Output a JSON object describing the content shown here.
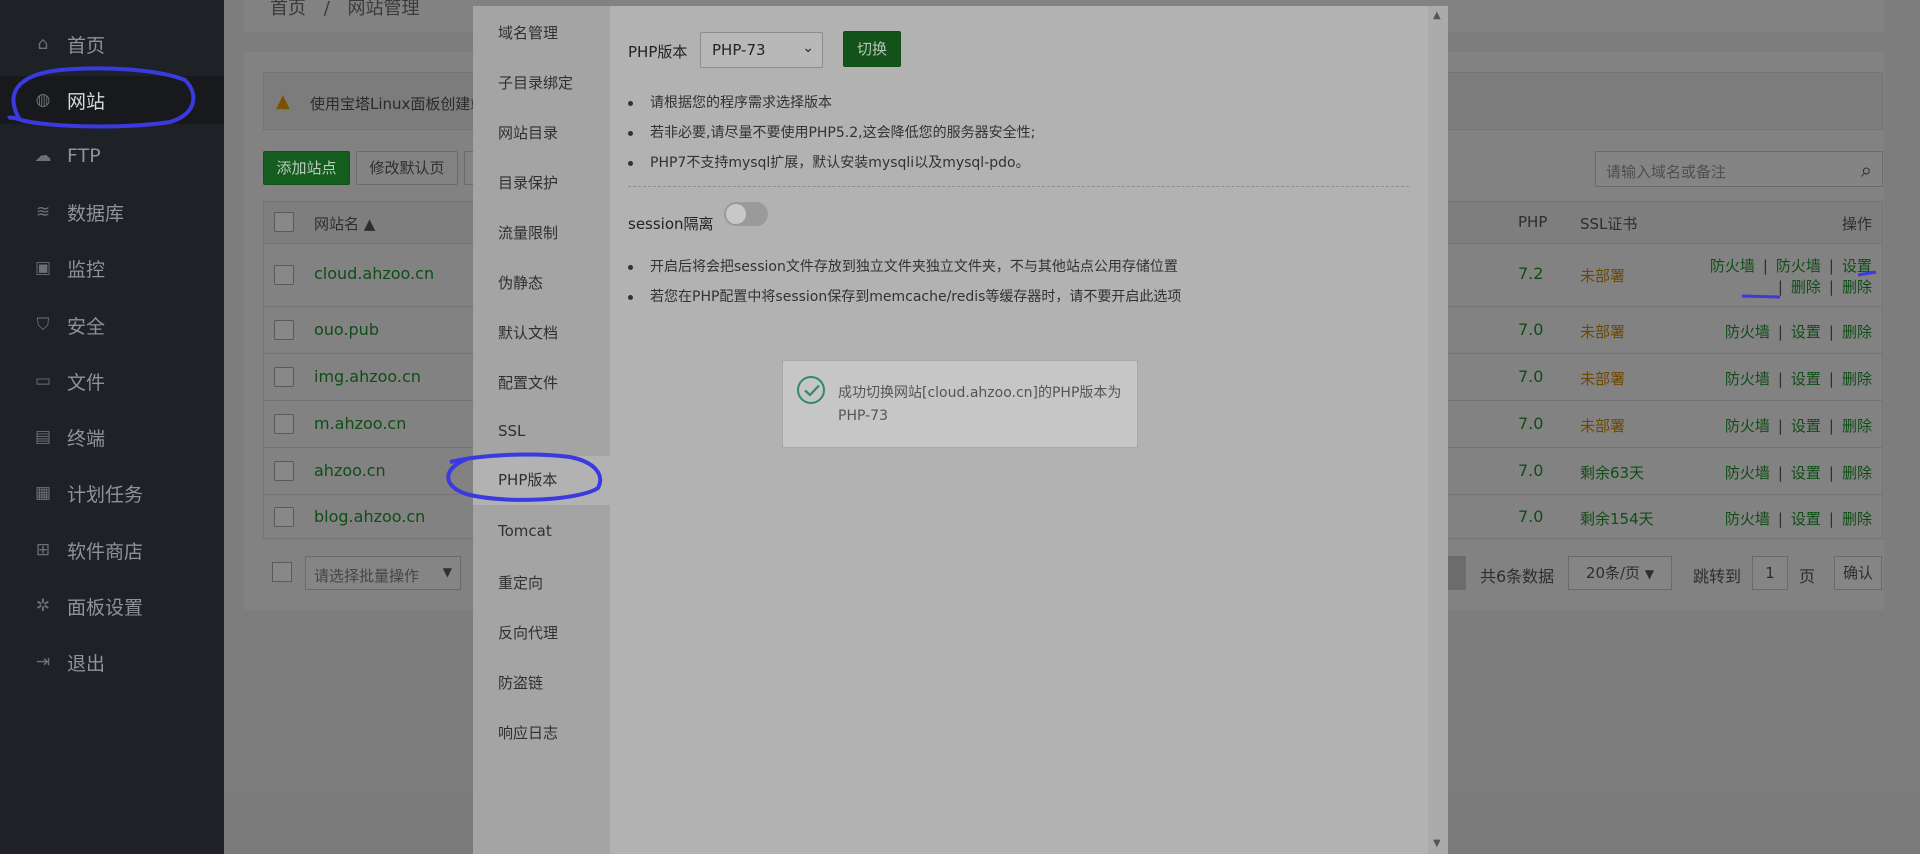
{
  "sidebar": {
    "items": [
      {
        "label": "首页",
        "icon": "home-icon",
        "glyph": "⌂"
      },
      {
        "label": "网站",
        "icon": "globe-icon",
        "glyph": "◍"
      },
      {
        "label": "FTP",
        "icon": "ftp-icon",
        "glyph": "☁"
      },
      {
        "label": "数据库",
        "icon": "database-icon",
        "glyph": "≋"
      },
      {
        "label": "监控",
        "icon": "monitor-icon",
        "glyph": "▣"
      },
      {
        "label": "安全",
        "icon": "shield-icon",
        "glyph": "⛉"
      },
      {
        "label": "文件",
        "icon": "folder-icon",
        "glyph": "▭"
      },
      {
        "label": "终端",
        "icon": "terminal-icon",
        "glyph": "▤"
      },
      {
        "label": "计划任务",
        "icon": "calendar-icon",
        "glyph": "▦"
      },
      {
        "label": "软件商店",
        "icon": "apps-icon",
        "glyph": "⊞"
      },
      {
        "label": "面板设置",
        "icon": "gear-icon",
        "glyph": "✲"
      },
      {
        "label": "退出",
        "icon": "logout-icon",
        "glyph": "⇥"
      }
    ]
  },
  "breadcrumb": {
    "home": "首页",
    "sep": "/",
    "current": "网站管理"
  },
  "alert": {
    "text": "使用宝塔Linux面板创建站"
  },
  "toolbar": {
    "add_site": "添加站点",
    "edit_default": "修改默认页"
  },
  "search": {
    "placeholder": "请输入域名或备注"
  },
  "table": {
    "headers": {
      "name": "网站名 ▲",
      "php": "PHP",
      "ssl": "SSL证书",
      "ops": "操作"
    },
    "rows": [
      {
        "name": "cloud.ahzoo.cn",
        "php": "7.2",
        "ssl": "未部署",
        "ssl_state": "warn",
        "op1": "防火墙",
        "op2": "防火墙",
        "op3": "设置",
        "op4": "删除"
      },
      {
        "name": "ouo.pub",
        "php": "7.0",
        "ssl": "未部署",
        "ssl_state": "warn",
        "op1": "防火墙",
        "op3": "设置",
        "op4": "删除"
      },
      {
        "name": "img.ahzoo.cn",
        "php": "7.0",
        "ssl": "未部署",
        "ssl_state": "warn",
        "op1": "防火墙",
        "op3": "设置",
        "op4": "删除"
      },
      {
        "name": "m.ahzoo.cn",
        "php": "7.0",
        "ssl": "未部署",
        "ssl_state": "warn",
        "op1": "防火墙",
        "op3": "设置",
        "op4": "删除"
      },
      {
        "name": "ahzoo.cn",
        "php": "7.0",
        "ssl": "剩余63天",
        "ssl_state": "ok",
        "op1": "防火墙",
        "op3": "设置",
        "op4": "删除"
      },
      {
        "name": "blog.ahzoo.cn",
        "php": "7.0",
        "ssl": "剩余154天",
        "ssl_state": "ok",
        "op1": "防火墙",
        "op3": "设置",
        "op4": "删除"
      }
    ]
  },
  "footer": {
    "batch_placeholder": "请选择批量操作",
    "total": "共6条数据",
    "per_page": "20条/页",
    "jump_label": "跳转到",
    "page_value": "1",
    "page_unit": "页",
    "confirm": "确认"
  },
  "modal": {
    "nav": [
      "域名管理",
      "子目录绑定",
      "网站目录",
      "目录保护",
      "流量限制",
      "伪静态",
      "默认文档",
      "配置文件",
      "SSL",
      "PHP版本",
      "Tomcat",
      "重定向",
      "反向代理",
      "防盗链",
      "响应日志"
    ],
    "active_index": 9,
    "php_label": "PHP版本",
    "php_selected": "PHP-73",
    "switch_btn": "切换",
    "tips1": [
      "请根据您的程序需求选择版本",
      "若非必要,请尽量不要使用PHP5.2,这会降低您的服务器安全性;",
      "PHP7不支持mysql扩展，默认安装mysqli以及mysql-pdo。"
    ],
    "session_label": "session隔离",
    "session_enabled": false,
    "tips2": [
      "开启后将会把session文件存放到独立文件夹独立文件夹，不与其他站点公用存储位置",
      "若您在PHP配置中将session保存到memcache/redis等缓存器时，请不要开启此选项"
    ]
  },
  "toast": {
    "message": "成功切换网站[cloud.ahzoo.cn]的PHP版本为PHP-73"
  },
  "colors": {
    "annotation": "#3a3adf",
    "accent": "#20a53a"
  }
}
